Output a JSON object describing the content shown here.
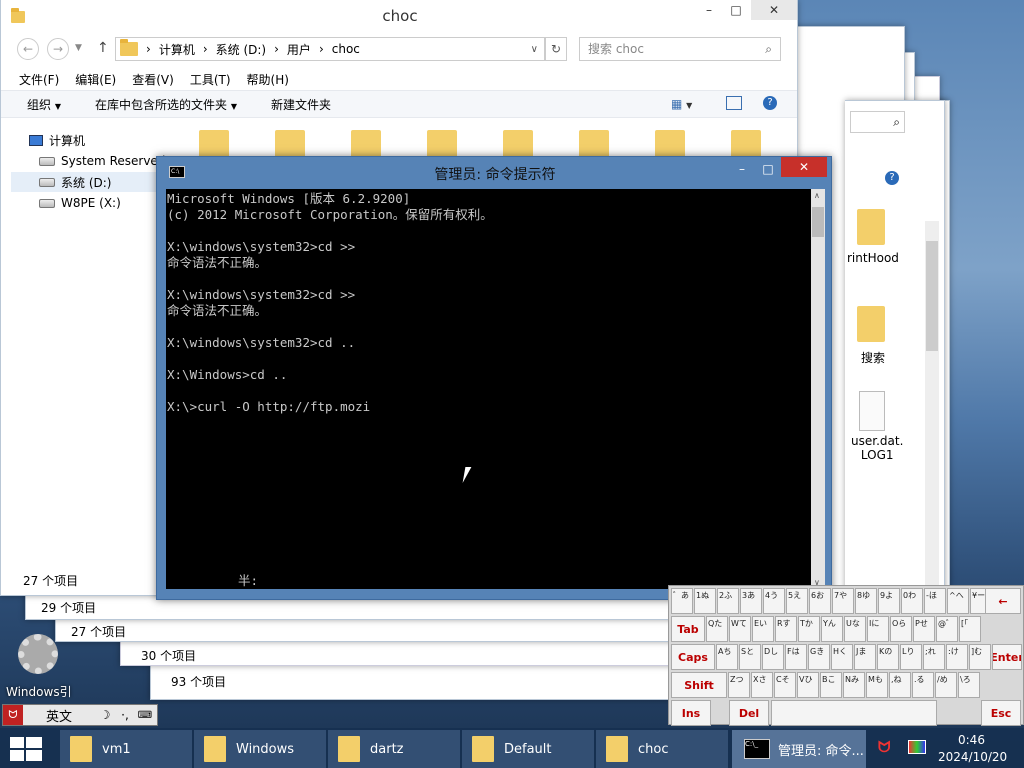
{
  "explorer_main": {
    "title": "choc",
    "path": [
      "计算机",
      "系统 (D:)",
      "用户",
      "choc"
    ],
    "search_placeholder": "搜索 choc",
    "menu": [
      "文件(F)",
      "编辑(E)",
      "查看(V)",
      "工具(T)",
      "帮助(H)"
    ],
    "toolbar": {
      "organize": "组织",
      "include_library": "在库中包含所选的文件夹",
      "new_folder": "新建文件夹"
    },
    "nav_tree": {
      "computer": "计算机",
      "drives": [
        "System Reserved",
        "系统 (D:)",
        "W8PE (X:)"
      ]
    },
    "status": "27 个项目"
  },
  "back_windows": {
    "status_items": [
      "29 个项目",
      "27 个项目",
      "30 个项目",
      "93 个项目"
    ],
    "right_items": [
      "rintHood",
      "搜索",
      "user.dat.\nLOG1"
    ]
  },
  "cmd": {
    "title": "管理员: 命令提示符",
    "lines": [
      "Microsoft Windows [版本 6.2.9200]",
      "(c) 2012 Microsoft Corporation。保留所有权利。",
      "",
      "X:\\windows\\system32>cd >>",
      "命令语法不正确。",
      "",
      "X:\\windows\\system32>cd >>",
      "命令语法不正确。",
      "",
      "X:\\windows\\system32>cd ..",
      "",
      "X:\\Windows>cd ..",
      "",
      "X:\\>curl -O http://ftp.mozi"
    ],
    "ime_status": "半:"
  },
  "desktop": {
    "icon_label": "Windows引",
    "ime_bar": {
      "mode": "英文"
    }
  },
  "keyboard": {
    "row1": [
      "゛あ",
      "1ぬ",
      "2ふ",
      "3あ",
      "4う",
      "5え",
      "6お",
      "7や",
      "8ゆ",
      "9よ",
      "0わ",
      "-ほ",
      "^へ",
      "¥ー"
    ],
    "keys": {
      "backspace": "←",
      "tab": "Tab",
      "caps": "Caps",
      "shift": "Shift",
      "enter": "Enter",
      "ins": "Ins",
      "del": "Del",
      "esc": "Esc"
    },
    "row2": [
      "Qた",
      "Wて",
      "Eい",
      "Rす",
      "Tか",
      "Yん",
      "Uな",
      "Iに",
      "Oら",
      "Pせ",
      "@゛",
      "[「"
    ],
    "row3": [
      "Aち",
      "Sと",
      "Dし",
      "Fは",
      "Gき",
      "Hく",
      "Jま",
      "Kの",
      "Lり",
      ";れ",
      ":け",
      "]む"
    ],
    "row4": [
      "Zつ",
      "Xさ",
      "Cそ",
      "Vひ",
      "Bこ",
      "Nみ",
      "Mも",
      ",ね",
      ".る",
      "/め",
      "\\ろ"
    ]
  },
  "taskbar": {
    "items": [
      "vm1",
      "Windows",
      "dartz",
      "Default",
      "choc",
      "管理员: 命令..."
    ],
    "time": "0:46",
    "date": "2024/10/20"
  },
  "colors": {
    "cmd_bg": "#000000",
    "close": "#c7302a",
    "taskbar": "#1e3a5c",
    "folder": "#f3cf6a"
  }
}
